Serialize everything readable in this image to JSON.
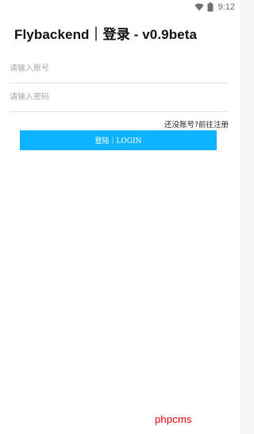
{
  "status_bar": {
    "time": "9:12",
    "icons": [
      "wifi-icon",
      "battery-icon"
    ]
  },
  "app": {
    "title": "Flybackend｜登录 - v0.9beta"
  },
  "form": {
    "account_placeholder": "请输入账号",
    "password_placeholder": "请输入密码",
    "register_link": "还没账号?前往注册",
    "login_button": "登陆｜LOGIN"
  },
  "watermark": "phpcms",
  "colors": {
    "accent": "#0eb4ff",
    "watermark": "#e30000"
  }
}
